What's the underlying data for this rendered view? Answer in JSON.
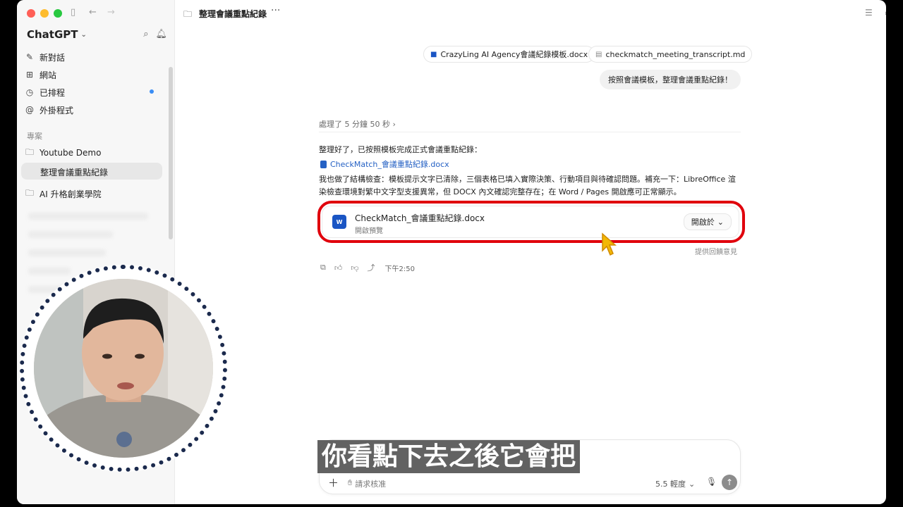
{
  "sidebar": {
    "app_name": "ChatGPT",
    "items": [
      {
        "icon": "edit-icon",
        "label": "新對話"
      },
      {
        "icon": "grid-icon",
        "label": "網站"
      },
      {
        "icon": "clock-icon",
        "label": "已排程"
      },
      {
        "icon": "at-icon",
        "label": "外掛程式"
      }
    ],
    "section_label": "專案",
    "projects": [
      {
        "label": "Youtube Demo"
      },
      {
        "label": "整理會議重點紀錄"
      },
      {
        "label": "AI 升格創業學院"
      }
    ]
  },
  "topbar": {
    "title": "整理會議重點紀錄",
    "more": "···"
  },
  "chat": {
    "attachments": [
      {
        "label": "CrazyLing AI Agency會議紀錄模板.docx"
      },
      {
        "label": "checkmatch_meeting_transcript.md"
      }
    ],
    "user_message": "按照會議模板，整理會議重點紀錄！",
    "processed": "處理了 5 分鐘 50 秒",
    "reply_intro": "整理好了，已按照模板完成正式會議重點紀錄：",
    "link_label": "CheckMatch_會議重點紀錄.docx",
    "reply_body": "我也做了結構檢查：模板提示文字已清除，三個表格已填入實際決策、行動項目與待確認問題。補充一下：LibreOffice 渲染檢查環境對繁中文字型支援異常，但 DOCX 內文確認完整存在；在 Word / Pages 開啟應可正常顯示。",
    "file_card": {
      "name": "CheckMatch_會議重點紀錄.docx",
      "sub": "開啟預覽",
      "open_label": "開啟於",
      "icon_text": "W"
    },
    "feedback": "提供回饋意見",
    "time": "下午2:50"
  },
  "composer": {
    "placeholder": "請求核准",
    "model": "5.5 輕度"
  },
  "subtitle": "你看點下去之後它會把",
  "colors": {
    "accent_red": "#e0000c",
    "link_blue": "#2561c4",
    "word_blue": "#1a55c4"
  }
}
